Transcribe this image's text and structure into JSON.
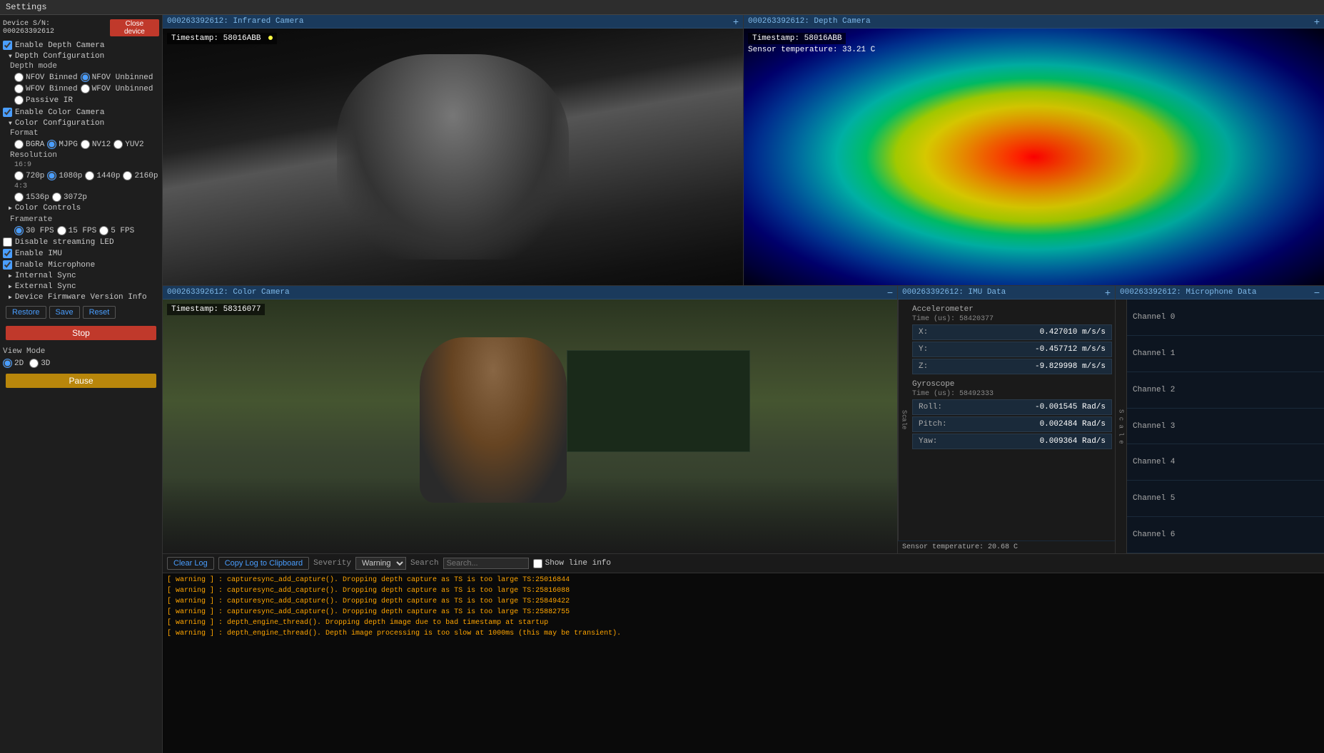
{
  "title_bar": {
    "text": "Settings"
  },
  "sidebar": {
    "device_label": "Device S/N: 000263392612",
    "close_device_btn": "Close device",
    "enable_depth": "Enable Depth Camera",
    "depth_config_label": "Depth Configuration",
    "depth_mode_label": "Depth mode",
    "depth_modes": [
      "NFOV Binned",
      "NFOV Unbinned",
      "WFOV Binned",
      "WFOV Unbinned",
      "Passive IR"
    ],
    "enable_color": "Enable Color Camera",
    "color_config_label": "Color Configuration",
    "format_label": "Format",
    "formats": [
      "BGRA",
      "MJPG",
      "NV12",
      "YUV2"
    ],
    "resolution_label": "Resolution",
    "res_16_9": "16:9",
    "res_16_9_options": [
      "720p",
      "1080p",
      "1440p",
      "2160p"
    ],
    "res_4_3": "4:3",
    "res_4_3_options": [
      "1536p",
      "3072p"
    ],
    "color_controls_label": "Color Controls",
    "framerate_label": "Framerate",
    "fps_options": [
      "30 FPS",
      "15 FPS",
      "5 FPS"
    ],
    "disable_streaming_led": "Disable streaming LED",
    "enable_imu": "Enable IMU",
    "enable_microphone": "Enable Microphone",
    "internal_sync": "Internal Sync",
    "external_sync": "External Sync",
    "firmware_info": "Device Firmware Version Info",
    "restore_btn": "Restore",
    "save_btn": "Save",
    "reset_btn": "Reset",
    "stop_btn": "Stop",
    "view_mode_label": "View Mode",
    "view_2d": "2D",
    "view_3d": "3D",
    "pause_btn": "Pause"
  },
  "ir_panel": {
    "title": "000263392612: Infrared Camera",
    "timestamp_label": "Timestamp:",
    "timestamp_value": "58016ABB"
  },
  "depth_panel": {
    "title": "000263392612: Depth Camera",
    "timestamp_label": "Timestamp:",
    "timestamp_value": "58016ABB",
    "sensor_temp": "Sensor temperature: 33.21 C"
  },
  "color_panel": {
    "title": "000263392612: Color Camera",
    "timestamp_label": "Timestamp:",
    "timestamp_value": "58316077"
  },
  "imu_panel": {
    "title": "000263392612: IMU Data",
    "accelerometer_label": "Accelerometer",
    "accel_time": "Time (us): 58420377",
    "accel_x_label": "X:",
    "accel_x_value": "0.427010 m/s/s",
    "accel_y_label": "Y:",
    "accel_y_value": "-0.457712 m/s/s",
    "accel_z_label": "Z:",
    "accel_z_value": "-9.829998 m/s/s",
    "gyroscope_label": "Gyroscope",
    "gyro_time": "Time (us): 58492333",
    "roll_label": "Roll:",
    "roll_value": "-0.001545 Rad/s",
    "pitch_label": "Pitch:",
    "pitch_value": "0.002484 Rad/s",
    "yaw_label": "Yaw:",
    "yaw_value": "0.009364 Rad/s",
    "sensor_temp": "Sensor temperature: 20.68 C",
    "scale_label": "S c a l e"
  },
  "mic_panel": {
    "title": "000263392612: Microphone Data",
    "channels": [
      "Channel 0",
      "Channel 1",
      "Channel 2",
      "Channel 3",
      "Channel 4",
      "Channel 5",
      "Channel 6"
    ],
    "scale_label": "S c a l e"
  },
  "log": {
    "clear_btn": "Clear Log",
    "copy_btn": "Copy Log to Clipboard",
    "severity_label": "Severity",
    "severity_value": "Warning",
    "search_label": "Search",
    "show_line_info": "Show line info",
    "lines": [
      "[ warning ] : capturesync_add_capture(). Dropping depth capture as TS is too large TS:25016844",
      "[ warning ] : capturesync_add_capture(). Dropping depth capture as TS is too large TS:25816088",
      "[ warning ] : capturesync_add_capture(). Dropping depth capture as TS is too large TS:25849422",
      "[ warning ] : capturesync_add_capture(). Dropping depth capture as TS is too large TS:25882755",
      "[ warning ] : depth_engine_thread(). Dropping depth image due to bad timestamp at startup",
      "[ warning ] : depth_engine_thread(). Depth image processing is too slow at 1000ms (this may be transient)."
    ]
  }
}
